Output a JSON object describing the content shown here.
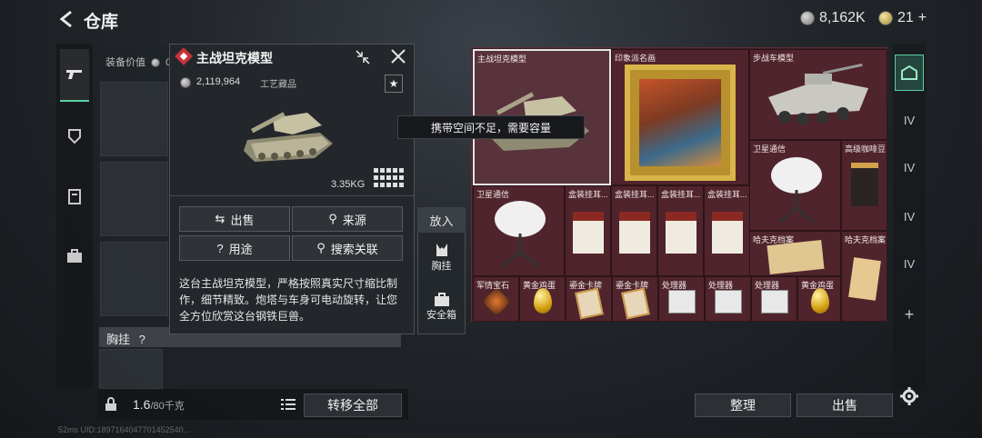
{
  "header": {
    "title": "仓库",
    "currency_amount": "8,162K",
    "premium_amount": "21",
    "add_symbol": "+"
  },
  "left_panel": {
    "equip_value_label": "装备价值",
    "equip_value_partial": "0",
    "chest_label": "胸挂",
    "chest_help": "?",
    "weight_value": "1.6",
    "weight_limit": "/80",
    "weight_unit": "千克",
    "transfer_all": "转移全部"
  },
  "popup": {
    "title": "主战坦克模型",
    "price": "2,119,964",
    "category": "工艺藏品",
    "weight": "3.35KG",
    "buttons": {
      "sell": "出售",
      "source": "来源",
      "usage": "用途",
      "search": "搜索关联"
    },
    "description": "这台主战坦克模型，严格按照真实尺寸缩比制作，细节精致。炮塔与车身可电动旋转，让您全方位欣赏这台钢铁巨兽。"
  },
  "put_in": {
    "title": "放入",
    "items": [
      "胸挂",
      "安全箱"
    ]
  },
  "tooltip": "携带空间不足，需要容量",
  "storage": {
    "items": [
      {
        "label": "主战坦克模型"
      },
      {
        "label": "印象派名画"
      },
      {
        "label": "步战车模型"
      },
      {
        "label": "卫星通信"
      },
      {
        "label": "高级咖啡豆"
      },
      {
        "label": "卫星通信"
      },
      {
        "label": "盒装挂耳..."
      },
      {
        "label": "盒装挂耳..."
      },
      {
        "label": "盒装挂耳..."
      },
      {
        "label": "盒装挂耳..."
      },
      {
        "label": "哈夫克档案"
      },
      {
        "label": "哈夫克档案"
      },
      {
        "label": "军情宝石"
      },
      {
        "label": "黄金鸡蛋"
      },
      {
        "label": "鎏金卡牌"
      },
      {
        "label": "鎏金卡牌"
      },
      {
        "label": "处理器"
      },
      {
        "label": "处理器"
      },
      {
        "label": "处理器"
      },
      {
        "label": "黄金鸡蛋"
      }
    ],
    "organize": "整理",
    "sell": "出售"
  },
  "right_nav": {
    "labels": [
      "IV",
      "IV",
      "IV",
      "IV",
      "+"
    ]
  },
  "status_bar": "52ms UID:1897164047701452540..."
}
